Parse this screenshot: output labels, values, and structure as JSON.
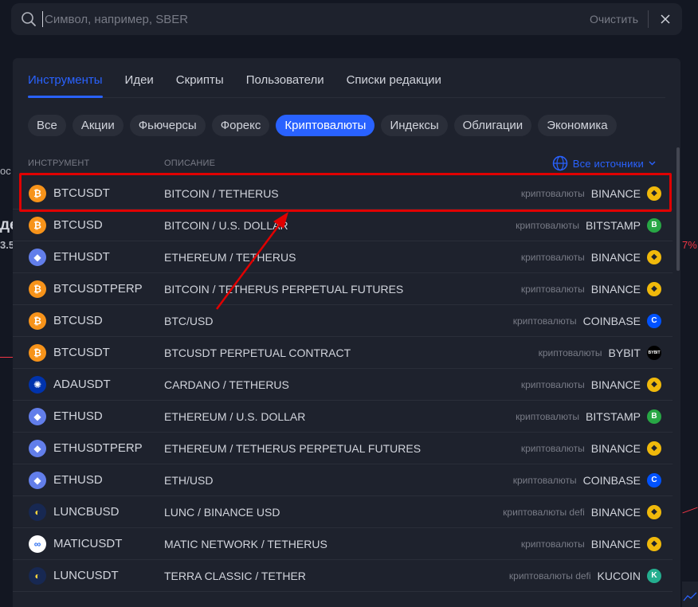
{
  "search": {
    "placeholder": "Символ, например, SBER",
    "clear_label": "Очистить"
  },
  "tabs": [
    {
      "label": "Инструменты",
      "active": true
    },
    {
      "label": "Идеи",
      "active": false
    },
    {
      "label": "Скрипты",
      "active": false
    },
    {
      "label": "Пользователи",
      "active": false
    },
    {
      "label": "Списки редакции",
      "active": false
    }
  ],
  "chips": [
    {
      "label": "Все",
      "active": false
    },
    {
      "label": "Акции",
      "active": false
    },
    {
      "label": "Фьючерсы",
      "active": false
    },
    {
      "label": "Форекс",
      "active": false
    },
    {
      "label": "Криптовалюты",
      "active": true
    },
    {
      "label": "Индексы",
      "active": false
    },
    {
      "label": "Облигации",
      "active": false
    },
    {
      "label": "Экономика",
      "active": false
    }
  ],
  "table": {
    "col_instrument": "ИНСТРУМЕНТ",
    "col_description": "ОПИСАНИЕ",
    "sources_label": "Все источники"
  },
  "rows": [
    {
      "symbol": "BTCUSDT",
      "description": "BITCOIN / TETHERUS",
      "category": "криптовалюты",
      "exchange": "BINANCE",
      "coin": "btc",
      "coin_glyph": "₿",
      "ex_icon": "binance",
      "ex_glyph": "◆"
    },
    {
      "symbol": "BTCUSD",
      "description": "BITCOIN / U.S. DOLLAR",
      "category": "криптовалюты",
      "exchange": "BITSTAMP",
      "coin": "btc",
      "coin_glyph": "₿",
      "ex_icon": "bitstamp",
      "ex_glyph": "B"
    },
    {
      "symbol": "ETHUSDT",
      "description": "ETHEREUM / TETHERUS",
      "category": "криптовалюты",
      "exchange": "BINANCE",
      "coin": "eth",
      "coin_glyph": "◆",
      "ex_icon": "binance",
      "ex_glyph": "◆"
    },
    {
      "symbol": "BTCUSDTPERP",
      "description": "BITCOIN / TETHERUS PERPETUAL FUTURES",
      "category": "криптовалюты",
      "exchange": "BINANCE",
      "coin": "btc",
      "coin_glyph": "₿",
      "ex_icon": "binance",
      "ex_glyph": "◆"
    },
    {
      "symbol": "BTCUSD",
      "description": "BTC/USD",
      "category": "криптовалюты",
      "exchange": "COINBASE",
      "coin": "btc",
      "coin_glyph": "₿",
      "ex_icon": "coinbase",
      "ex_glyph": "C"
    },
    {
      "symbol": "BTCUSDT",
      "description": "BTCUSDT PERPETUAL CONTRACT",
      "category": "криптовалюты",
      "exchange": "BYBIT",
      "coin": "btc",
      "coin_glyph": "₿",
      "ex_icon": "bybit",
      "ex_glyph": "BYBIT"
    },
    {
      "symbol": "ADAUSDT",
      "description": "CARDANO / TETHERUS",
      "category": "криптовалюты",
      "exchange": "BINANCE",
      "coin": "ada",
      "coin_glyph": "✺",
      "ex_icon": "binance",
      "ex_glyph": "◆"
    },
    {
      "symbol": "ETHUSD",
      "description": "ETHEREUM / U.S. DOLLAR",
      "category": "криптовалюты",
      "exchange": "BITSTAMP",
      "coin": "eth",
      "coin_glyph": "◆",
      "ex_icon": "bitstamp",
      "ex_glyph": "B"
    },
    {
      "symbol": "ETHUSDTPERP",
      "description": "ETHEREUM / TETHERUS PERPETUAL FUTURES",
      "category": "криптовалюты",
      "exchange": "BINANCE",
      "coin": "eth",
      "coin_glyph": "◆",
      "ex_icon": "binance",
      "ex_glyph": "◆"
    },
    {
      "symbol": "ETHUSD",
      "description": "ETH/USD",
      "category": "криптовалюты",
      "exchange": "COINBASE",
      "coin": "eth",
      "coin_glyph": "◆",
      "ex_icon": "coinbase",
      "ex_glyph": "C"
    },
    {
      "symbol": "LUNCBUSD",
      "description": "LUNC / BINANCE USD",
      "category": "криптовалюты defi",
      "exchange": "BINANCE",
      "coin": "lunc",
      "coin_glyph": "◐",
      "ex_icon": "binance",
      "ex_glyph": "◆"
    },
    {
      "symbol": "MATICUSDT",
      "description": "MATIC NETWORK / TETHERUS",
      "category": "криптовалюты",
      "exchange": "BINANCE",
      "coin": "matic",
      "coin_glyph": "∞",
      "ex_icon": "binance",
      "ex_glyph": "◆"
    },
    {
      "symbol": "LUNCUSDT",
      "description": "TERRA CLASSIC / TETHER",
      "category": "криптовалюты defi",
      "exchange": "KUCOIN",
      "coin": "lunc",
      "coin_glyph": "◐",
      "ex_icon": "kucoin",
      "ex_glyph": "K"
    }
  ],
  "background": {
    "frag1": "oc",
    "frag2": "де",
    "frag3": "3.5",
    "frag4": "7%"
  },
  "colors": {
    "accent": "#2962ff",
    "highlight": "#e00000",
    "bg": "#131722",
    "panel": "#1e222d"
  }
}
